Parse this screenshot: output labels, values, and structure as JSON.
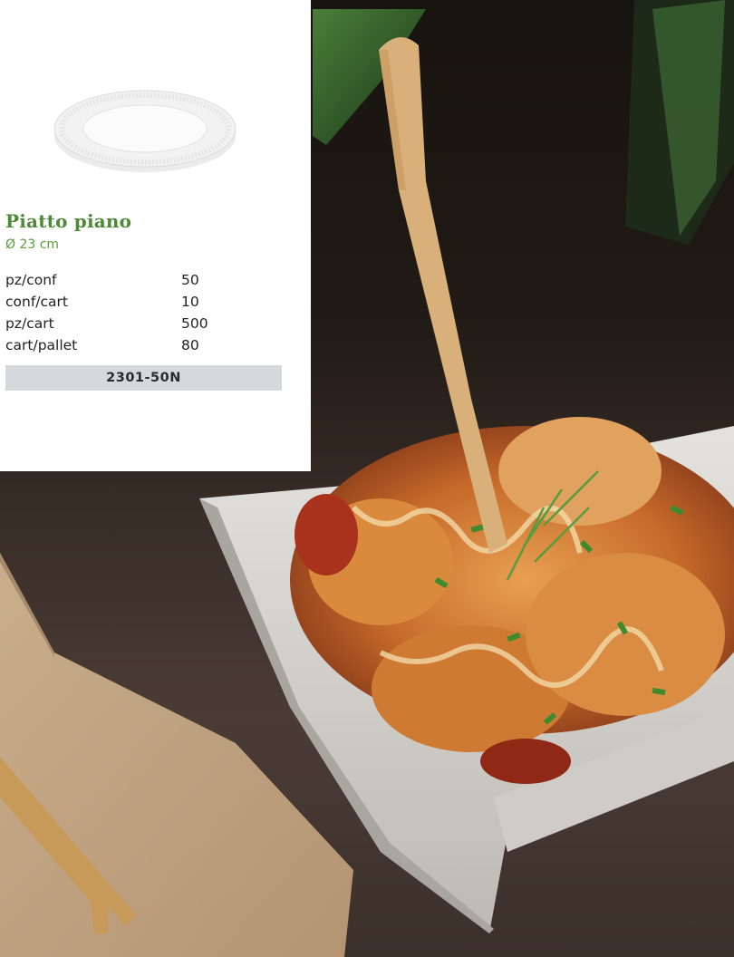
{
  "product": {
    "name": "Piatto piano",
    "size": "Ø 23 cm",
    "specs": [
      {
        "label": "pz/conf",
        "value": "50"
      },
      {
        "label": "conf/cart",
        "value": "10"
      },
      {
        "label": "pz/cart",
        "value": "500"
      },
      {
        "label": "cart/pallet",
        "value": "80"
      }
    ],
    "code": "2301-50N"
  },
  "colors": {
    "brand_green": "#4d8a35",
    "code_bar": "#d6d9dc"
  }
}
